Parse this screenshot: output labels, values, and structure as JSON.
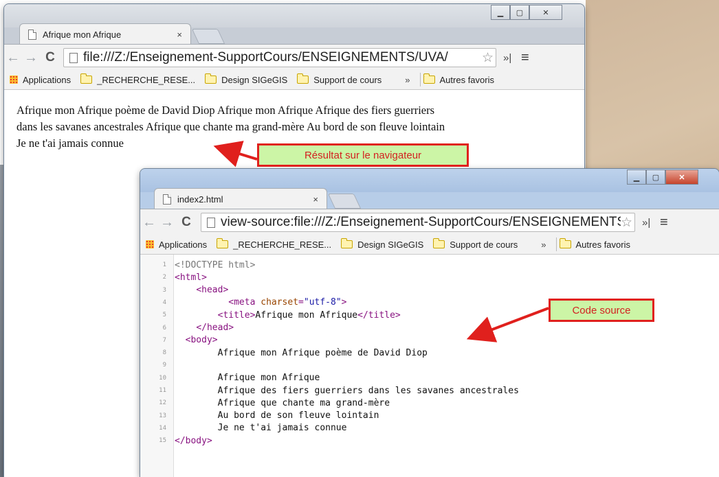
{
  "browser1": {
    "tab_title": "Afrique mon Afrique",
    "tab_close": "×",
    "url": "file:///Z:/Enseignement-SupportCours/ENSEIGNEMENTS/UVA/",
    "bookmarks": {
      "apps": "Applications",
      "items": [
        "_RECHERCHE_RESE...",
        "Design SIGeGIS",
        "Support de cours"
      ],
      "more": "»",
      "other": "Autres favoris"
    },
    "content_lines": [
      "Afrique mon Afrique poème de David Diop Afrique mon Afrique Afrique des fiers guerriers",
      "dans les savanes ancestrales Afrique que chante ma grand-mère Au bord de son fleuve lointain",
      "Je ne t'ai jamais connue"
    ]
  },
  "browser2": {
    "tab_title": "index2.html",
    "tab_close": "×",
    "url": "view-source:file:///Z:/Enseignement-SupportCours/ENSEIGNEMENTS/UVA/",
    "bookmarks": {
      "apps": "Applications",
      "items": [
        "_RECHERCHE_RESE...",
        "Design SIGeGIS",
        "Support de cours"
      ],
      "more": "»",
      "other": "Autres favoris"
    },
    "source_lines": [
      {
        "n": "1",
        "parts": [
          {
            "c": "c-doctype",
            "t": "<!DOCTYPE html>"
          }
        ]
      },
      {
        "n": "2",
        "parts": [
          {
            "c": "c-tag",
            "t": "<html>"
          }
        ]
      },
      {
        "n": "3",
        "parts": [
          {
            "c": "",
            "t": "    "
          },
          {
            "c": "c-tag",
            "t": "<head>"
          }
        ]
      },
      {
        "n": "4",
        "parts": [
          {
            "c": "",
            "t": "          "
          },
          {
            "c": "c-tag",
            "t": "<meta "
          },
          {
            "c": "c-attr",
            "t": "charset"
          },
          {
            "c": "c-tag",
            "t": "="
          },
          {
            "c": "c-val",
            "t": "\"utf-8\""
          },
          {
            "c": "c-tag",
            "t": ">"
          }
        ]
      },
      {
        "n": "5",
        "parts": [
          {
            "c": "",
            "t": "        "
          },
          {
            "c": "c-tag",
            "t": "<title>"
          },
          {
            "c": "",
            "t": "Afrique mon Afrique"
          },
          {
            "c": "c-tag",
            "t": "</title>"
          }
        ]
      },
      {
        "n": "6",
        "parts": [
          {
            "c": "",
            "t": "    "
          },
          {
            "c": "c-tag",
            "t": "</head>"
          }
        ]
      },
      {
        "n": "7",
        "parts": [
          {
            "c": "",
            "t": "  "
          },
          {
            "c": "c-tag",
            "t": "<body>"
          }
        ]
      },
      {
        "n": "8",
        "parts": [
          {
            "c": "",
            "t": "        Afrique mon Afrique poème de David Diop"
          }
        ]
      },
      {
        "n": "9",
        "parts": [
          {
            "c": "",
            "t": ""
          }
        ]
      },
      {
        "n": "10",
        "parts": [
          {
            "c": "",
            "t": "        Afrique mon Afrique"
          }
        ]
      },
      {
        "n": "11",
        "parts": [
          {
            "c": "",
            "t": "        Afrique des fiers guerriers dans les savanes ancestrales"
          }
        ]
      },
      {
        "n": "12",
        "parts": [
          {
            "c": "",
            "t": "        Afrique que chante ma grand-mère"
          }
        ]
      },
      {
        "n": "13",
        "parts": [
          {
            "c": "",
            "t": "        Au bord de son fleuve lointain"
          }
        ]
      },
      {
        "n": "14",
        "parts": [
          {
            "c": "",
            "t": "        Je ne t'ai jamais connue"
          }
        ]
      },
      {
        "n": "15",
        "parts": [
          {
            "c": "c-tag",
            "t": "</body>"
          }
        ]
      }
    ]
  },
  "annotations": {
    "result_label": "Résultat sur le navigateur",
    "source_label": "Code source"
  },
  "colors": {
    "callout_border": "#e0201d",
    "callout_fill": "#ccf5a6",
    "callout_text": "#d32121"
  }
}
